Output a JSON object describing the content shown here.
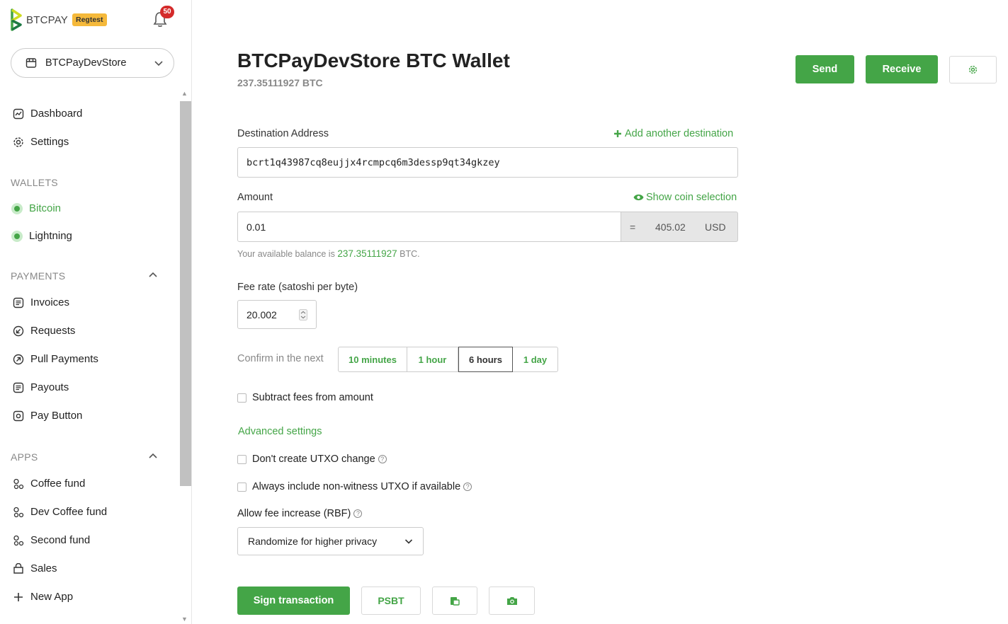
{
  "brand": {
    "name": "BTCPAY",
    "network_badge": "Regtest"
  },
  "notifications": {
    "count": "50"
  },
  "store": {
    "name": "BTCPayDevStore"
  },
  "nav": {
    "dashboard": "Dashboard",
    "settings": "Settings",
    "wallets_label": "WALLETS",
    "bitcoin": "Bitcoin",
    "lightning": "Lightning",
    "payments_label": "PAYMENTS",
    "invoices": "Invoices",
    "requests": "Requests",
    "pull_payments": "Pull Payments",
    "payouts": "Payouts",
    "pay_button": "Pay Button",
    "apps_label": "APPS",
    "coffee_fund": "Coffee fund",
    "dev_coffee_fund": "Dev Coffee fund",
    "second_fund": "Second fund",
    "sales": "Sales",
    "new_app": "New App"
  },
  "page": {
    "title": "BTCPayDevStore BTC Wallet",
    "balance": "237.35111927 BTC",
    "send_label": "Send",
    "receive_label": "Receive"
  },
  "form": {
    "destination_label": "Destination Address",
    "add_destination": "Add another destination",
    "destination_value": "bcrt1q43987cq8eujjx4rcmpcq6m3dessp9qt34gkzey",
    "amount_label": "Amount",
    "show_coin_selection": "Show coin selection",
    "amount_value": "0.01",
    "equals": "=",
    "fiat_value": "405.02",
    "fiat_currency": "USD",
    "balance_prefix": "Your available balance is",
    "balance_amount": "237.35111927",
    "balance_suffix": "BTC.",
    "fee_label": "Fee rate (satoshi per byte)",
    "fee_value": "20.002",
    "confirm_label": "Confirm in the next",
    "confirm_options": [
      "10 minutes",
      "1 hour",
      "6 hours",
      "1 day"
    ],
    "confirm_selected": "6 hours",
    "subtract_fees": "Subtract fees from amount",
    "advanced": "Advanced settings",
    "no_change": "Don't create UTXO change",
    "non_witness": "Always include non-witness UTXO if available",
    "rbf_label": "Allow fee increase (RBF)",
    "rbf_value": "Randomize for higher privacy",
    "sign_label": "Sign transaction",
    "psbt_label": "PSBT"
  },
  "colors": {
    "accent": "#44a547",
    "badge": "#d42a2a",
    "regtest": "#f5b93b"
  }
}
